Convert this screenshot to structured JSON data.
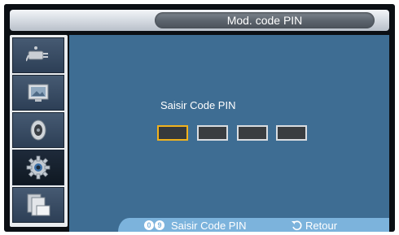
{
  "window": {
    "title": "Mod. code PIN"
  },
  "sidebar": {
    "items": [
      {
        "icon": "input-plug-icon",
        "active": false
      },
      {
        "icon": "picture-icon",
        "active": false
      },
      {
        "icon": "sound-icon",
        "active": false
      },
      {
        "icon": "setup-gear-icon",
        "active": true
      },
      {
        "icon": "multi-window-icon",
        "active": false
      }
    ]
  },
  "main": {
    "pin_label": "Saisir Code PIN",
    "pin_digits": [
      "",
      "",
      "",
      ""
    ],
    "focused_digit_index": 0
  },
  "footer": {
    "digit_keys": [
      "0",
      "9"
    ],
    "enter_pin_hint": "Saisir Code PIN",
    "return_label": "Retour"
  },
  "colors": {
    "content_bg": "#3e6d93",
    "focus_border": "#f0b21e",
    "hint_bar": "#7cb3dc"
  }
}
